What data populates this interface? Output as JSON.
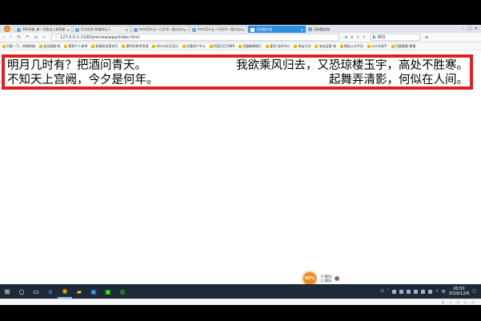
{
  "tabs": [
    {
      "label": "360导航_新一代安全上网导航",
      "active": false
    },
    {
      "label": "百方任务-知道你认人",
      "active": false
    },
    {
      "label": "html怎么让一行文字一部分左对齐",
      "active": false
    },
    {
      "label": "html怎么让一行文字一部分右对齐",
      "active": false
    },
    {
      "label": "无标题文档",
      "active": true
    },
    {
      "label": "无标题文档",
      "active": false
    }
  ],
  "address": {
    "url": "127.0.0.1:1190/preview/app/index.html",
    "search_engine_glyph": "b",
    "search_text": "诗句"
  },
  "bookmarks": [
    "百度一下，你就知道",
    "会议提纲-知",
    "策划个人参考",
    "新媒体运营技巧",
    "便利的参考资源",
    "Azure交互设计",
    "优惠用户中心",
    "阿里巴巴1688",
    "豆瓣编辑银行",
    "爱奇-创作中心",
    "淘宝大学",
    "淘宝运营-海",
    "微信公众平台",
    "公众号助手",
    "百度脑图-便捷"
  ],
  "poem": {
    "line1_left": "明月几时有？把酒问青天。",
    "line1_right": "我欲乘风归去，又恐琼楼玉宇，高处不胜寒。",
    "line2_left": "不知天上宫阙，今夕是何年。",
    "line2_right": "起舞弄清影，何似在人间。"
  },
  "speed_widget": {
    "percent": "85%",
    "up": "0K/s",
    "down": "0K/s"
  },
  "clock": {
    "time": "20:50",
    "date": "2018/12/6"
  },
  "colors": {
    "accent_tab": "#2f8de4",
    "poem_border": "#e02020",
    "taskbar": "#1f2a38"
  }
}
